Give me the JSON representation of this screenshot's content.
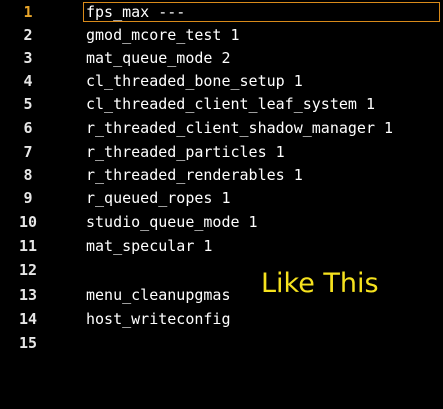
{
  "editor": {
    "current_line": 1,
    "lines": [
      {
        "number": "1",
        "text": "fps_max ---"
      },
      {
        "number": "2",
        "text": "gmod_mcore_test 1"
      },
      {
        "number": "3",
        "text": "mat_queue_mode 2"
      },
      {
        "number": "4",
        "text": "cl_threaded_bone_setup 1"
      },
      {
        "number": "5",
        "text": "cl_threaded_client_leaf_system 1"
      },
      {
        "number": "6",
        "text": "r_threaded_client_shadow_manager 1"
      },
      {
        "number": "7",
        "text": "r_threaded_particles 1"
      },
      {
        "number": "8",
        "text": "r_threaded_renderables 1"
      },
      {
        "number": "9",
        "text": "r_queued_ropes 1"
      },
      {
        "number": "10",
        "text": "studio_queue_mode 1"
      },
      {
        "number": "11",
        "text": "mat_specular 1"
      },
      {
        "number": "12",
        "text": ""
      },
      {
        "number": "13",
        "text": "menu_cleanupgmas"
      },
      {
        "number": "14",
        "text": "host_writeconfig"
      },
      {
        "number": "15",
        "text": ""
      }
    ]
  },
  "annotation": {
    "text": "Like This",
    "color": "#f6e21e"
  },
  "colors": {
    "background": "#000000",
    "text": "#ffffff",
    "current_line_number": "#e8a52a",
    "current_line_border": "#d88a1a"
  }
}
